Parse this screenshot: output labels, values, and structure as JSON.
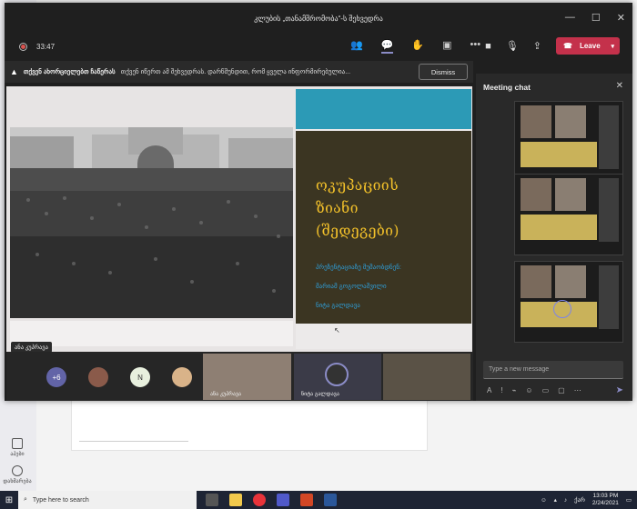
{
  "window": {
    "title": "კლუბის „თანამშრომობა“-ს შეხვედრა"
  },
  "meeting": {
    "timer": "33:47",
    "leave_label": "Leave"
  },
  "banner": {
    "bold_text": "თქვენ ახორციელებთ ჩაწერას",
    "message": "თქვენ იწერთ ამ შეხვედრას. დარწმუნდით, რომ ყველა ინფორმირებულია...",
    "dismiss_label": "Dismiss"
  },
  "slide": {
    "title": "ოკუპაციის\nზიანი\n(შედეგები)",
    "sub1": "პრეზენტაციაზე მუშაობდნენ:",
    "sub2": "მარიამ გოგოლაშვილი",
    "sub3": "ნიტა გალდავა"
  },
  "stage": {
    "presenter_name": "ანა კუპრავა"
  },
  "participants": {
    "more_count": "+6",
    "initial_n": "N",
    "tile1_name": "ანა კუპრავა",
    "tile2_name": "ნიტა გალდავა"
  },
  "chat": {
    "title": "Meeting chat",
    "input_placeholder": "Type a new message"
  },
  "taskbar": {
    "search_placeholder": "Type here to search",
    "lang": "ქარ",
    "time": "13:03 PM",
    "date": "2/24/2021"
  },
  "left_nav": {
    "item1": "აპები",
    "item2": "დახმარება"
  },
  "colors": {
    "leave": "#c4314b",
    "slide_title": "#f3c12a",
    "slide_cyan": "#2c9ab6",
    "slide_dark": "#3b3522",
    "accent": "#7b83eb"
  }
}
